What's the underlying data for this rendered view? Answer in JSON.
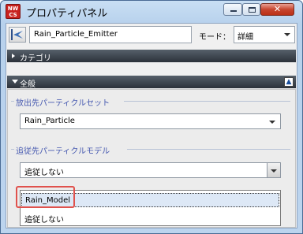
{
  "window": {
    "app_icon_text": "NW\nCS",
    "title": "プロパティパネル",
    "close_glyph": "✕",
    "app_icon_color": "#c9221f"
  },
  "header": {
    "emitter_name": "Rain_Particle_Emitter",
    "mode_label": "モード：",
    "mode_value": "詳細"
  },
  "sections": {
    "category": "カテゴリ",
    "all": "全般"
  },
  "emission": {
    "label": "放出先パーティクルセット",
    "value": "Rain_Particle"
  },
  "follow": {
    "label": "追従先パーティクルモデル",
    "value": "追従しない",
    "options": [
      "Rain_Model",
      "追従しない"
    ]
  },
  "colors": {
    "accent_label": "#4659b0",
    "highlight_border": "#e0524d",
    "section_bar": "#3a4149"
  }
}
